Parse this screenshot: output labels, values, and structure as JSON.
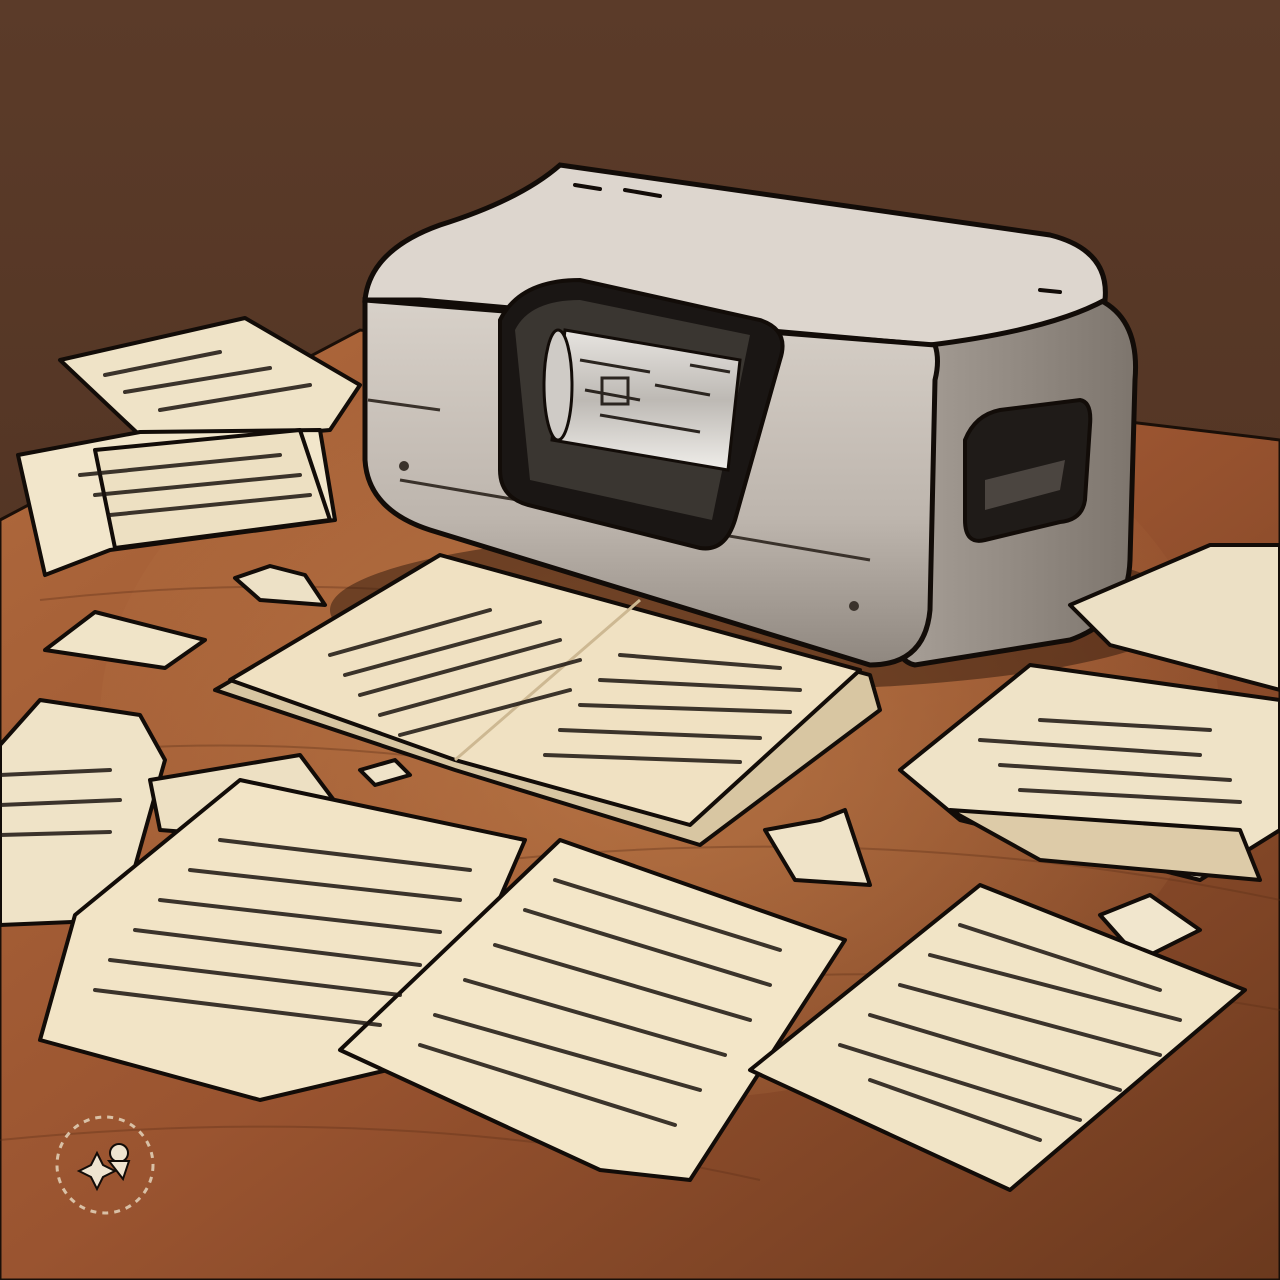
{
  "scene": {
    "subject": "shredder-printer",
    "colors": {
      "wall_top": "#5a3a28",
      "wall_bottom": "#3e2618",
      "desk_light": "#a8643a",
      "desk_dark": "#6e3c20",
      "machine_body": "#cbc4bd",
      "machine_shadow": "#8f877f",
      "paper": "#efe1c4",
      "paper_shade": "#d9c7a3",
      "ink": "#1c1510",
      "outline": "#120c08"
    }
  },
  "watermark": {
    "icon": "sparkle-badge-icon"
  }
}
